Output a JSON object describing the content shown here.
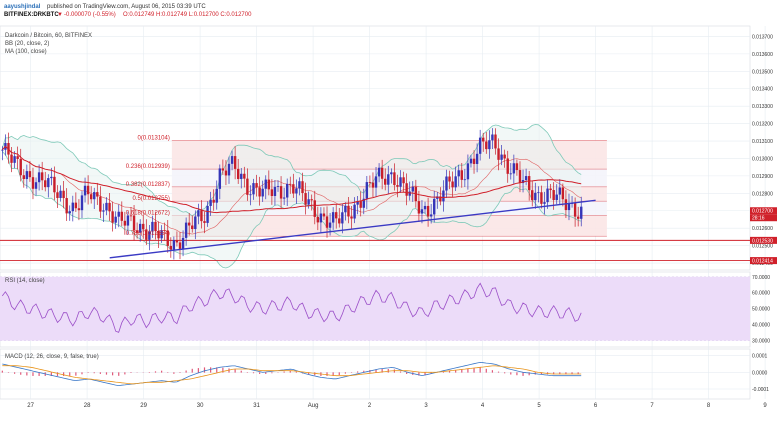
{
  "header": {
    "author": "aayushjindal",
    "published_text": "published on TradingView.com, August 06, 2015 03:39 UTC",
    "symbol": "BITFINEX:DRKBTC",
    "change_arrow": "▼",
    "change": "-0.000070 (-0.55%)",
    "ohlc": "O:0.012749 H:0.012749 L:0.012700 C:0.012700"
  },
  "chart_data": [
    {
      "type": "candlestick",
      "pane": "price",
      "title": "Darkcoin / Bitcoin, 60, BITFINEX",
      "indicators": [
        "BB (20, close, 2)",
        "MA (100, close)"
      ],
      "x_ticks": [
        "27",
        "28",
        "29",
        "30",
        "31",
        "Aug",
        "2",
        "3",
        "4",
        "5",
        "6",
        "7",
        "8",
        "9"
      ],
      "y_ticks": [
        0.0137,
        0.0136,
        0.0135,
        0.0134,
        0.0133,
        0.0132,
        0.0131,
        0.013,
        0.0129,
        0.0128,
        0.0127,
        0.0126,
        0.0125,
        0.0124
      ],
      "ylim": [
        0.01236,
        0.01376
      ],
      "close_series": [
        0.01305,
        0.01295,
        0.0129,
        0.01285,
        0.0128,
        0.0127,
        0.0128,
        0.01275,
        0.01262,
        0.01265,
        0.01258,
        0.01255,
        0.01252,
        0.0126,
        0.01268,
        0.0129,
        0.01295,
        0.01285,
        0.0128,
        0.01282,
        0.01285,
        0.01275,
        0.01268,
        0.01262,
        0.0127,
        0.0128,
        0.01288,
        0.01292,
        0.0128,
        0.0127,
        0.01276,
        0.01285,
        0.01295,
        0.01305,
        0.0131,
        0.01295,
        0.01285,
        0.0128,
        0.01278,
        0.01275,
        0.0127
      ],
      "fib_levels": [
        {
          "label": "0(0.013104)",
          "value": 0.013104
        },
        {
          "label": "0.236(0.012939)",
          "value": 0.012939
        },
        {
          "label": "0.382(0.012837)",
          "value": 0.012837
        },
        {
          "label": "0.5(0.012755)",
          "value": 0.012755
        },
        {
          "label": "0.618(0.012672)",
          "value": 0.012672
        },
        {
          "label": "0.786(0.012554)",
          "value": 0.012554
        }
      ],
      "trendline": {
        "from": [
          1.8,
          0.01243
        ],
        "to": [
          10.4,
          0.01276
        ]
      },
      "horizontal_lines": [
        0.01253,
        0.012414
      ],
      "price_labels": [
        {
          "text": "0.012700",
          "value": 0.0127,
          "color": "#d0202a"
        },
        {
          "text": "28:16",
          "value": 0.01266,
          "color": "#d0202a"
        },
        {
          "text": "0.012530",
          "value": 0.01253,
          "color": "#d0202a"
        },
        {
          "text": "0.012414",
          "value": 0.012414,
          "color": "#d0202a"
        }
      ]
    },
    {
      "type": "line",
      "pane": "rsi",
      "title": "RSI (14, close)",
      "y_ticks": [
        70,
        60,
        50,
        40,
        30
      ],
      "y_tick_labels": [
        "70.0000",
        "60.0000",
        "50.0000",
        "40.0000",
        "30.0000"
      ],
      "ylim": [
        26,
        73
      ],
      "band": [
        30,
        70
      ],
      "values": [
        58,
        52,
        50,
        47,
        45,
        43,
        48,
        45,
        38,
        44,
        42,
        45,
        44,
        52,
        55,
        60,
        58,
        52,
        50,
        52,
        54,
        48,
        46,
        45,
        50,
        55,
        58,
        56,
        50,
        47,
        52,
        55,
        58,
        62,
        60,
        52,
        50,
        48,
        48,
        47,
        45
      ]
    },
    {
      "type": "line",
      "pane": "macd",
      "title": "MACD (12, 26, close, 9, false, true)",
      "y_ticks": [
        0.0001,
        0,
        -0.0001
      ],
      "y_tick_labels": [
        "0.0001",
        "0.0000",
        "-0.0001"
      ],
      "ylim": [
        -0.00016,
        0.00014
      ],
      "series": [
        {
          "role": "macd",
          "color": "#3a78c8",
          "values": [
            5e-05,
            3e-05,
            1e-05,
            -1e-05,
            -3e-05,
            -5e-05,
            -4e-05,
            -6e-05,
            -8e-05,
            -7e-05,
            -6e-05,
            -5e-05,
            -6e-05,
            -2e-05,
            1e-05,
            3e-05,
            4e-05,
            2e-05,
            0.0,
            1e-05,
            2e-05,
            -1e-05,
            -3e-05,
            -4e-05,
            -2e-05,
            0.0,
            2e-05,
            3e-05,
            0.0,
            -2e-05,
            0.0,
            2e-05,
            4e-05,
            6e-05,
            5e-05,
            2e-05,
            0.0,
            -1e-05,
            -2e-05,
            -2e-05,
            -2e-05
          ]
        },
        {
          "role": "signal",
          "color": "#e8941a",
          "values": [
            4e-05,
            4e-05,
            3e-05,
            1e-05,
            -1e-05,
            -3e-05,
            -4e-05,
            -5e-05,
            -6e-05,
            -7e-05,
            -6e-05,
            -6e-05,
            -5e-05,
            -4e-05,
            -2e-05,
            0.0,
            2e-05,
            2e-05,
            1e-05,
            1e-05,
            1e-05,
            0.0,
            -1e-05,
            -2e-05,
            -2e-05,
            -1e-05,
            0.0,
            1e-05,
            1e-05,
            0.0,
            0.0,
            1e-05,
            2e-05,
            3e-05,
            4e-05,
            3e-05,
            2e-05,
            0.0,
            -1e-05,
            -1e-05,
            -1e-05
          ]
        }
      ]
    }
  ],
  "colors": {
    "up": "#3535b8",
    "down": "#c81e2a",
    "bb": "#7ec9b8",
    "ma": "#d0202a",
    "trend": "#3a3ac4",
    "rsi_line": "#9b4fc8",
    "rsi_band": "#ecdcf9",
    "grid": "#e6ecf2",
    "fib_fill": "#fbe6e6"
  }
}
